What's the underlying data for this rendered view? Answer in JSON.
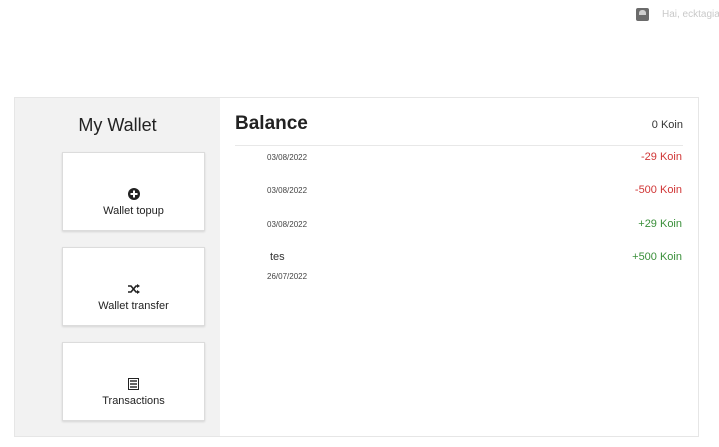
{
  "header": {
    "user_icon": "user-avatar-icon",
    "user_name": "Hai, ecktagia"
  },
  "sidebar": {
    "title": "My Wallet",
    "cards": [
      {
        "label": "Wallet topup",
        "icon": "plus-circle-icon"
      },
      {
        "label": "Wallet transfer",
        "icon": "shuffle-icon"
      },
      {
        "label": "Transactions",
        "icon": "list-icon"
      }
    ]
  },
  "main": {
    "title": "Balance",
    "balance": "0 Koin",
    "transactions": [
      {
        "date": "03/08/2022",
        "note": "",
        "amount": "-29 Koin",
        "type": "debit"
      },
      {
        "date": "03/08/2022",
        "note": "",
        "amount": "-500 Koin",
        "type": "debit"
      },
      {
        "date": "03/08/2022",
        "note": "",
        "amount": "+29 Koin",
        "type": "credit"
      },
      {
        "date": "26/07/2022",
        "note": "tes",
        "amount": "+500 Koin",
        "type": "credit"
      }
    ]
  },
  "colors": {
    "debit": "#d03535",
    "credit": "#3a8f3a",
    "sidebar_bg": "#f2f2f2"
  }
}
